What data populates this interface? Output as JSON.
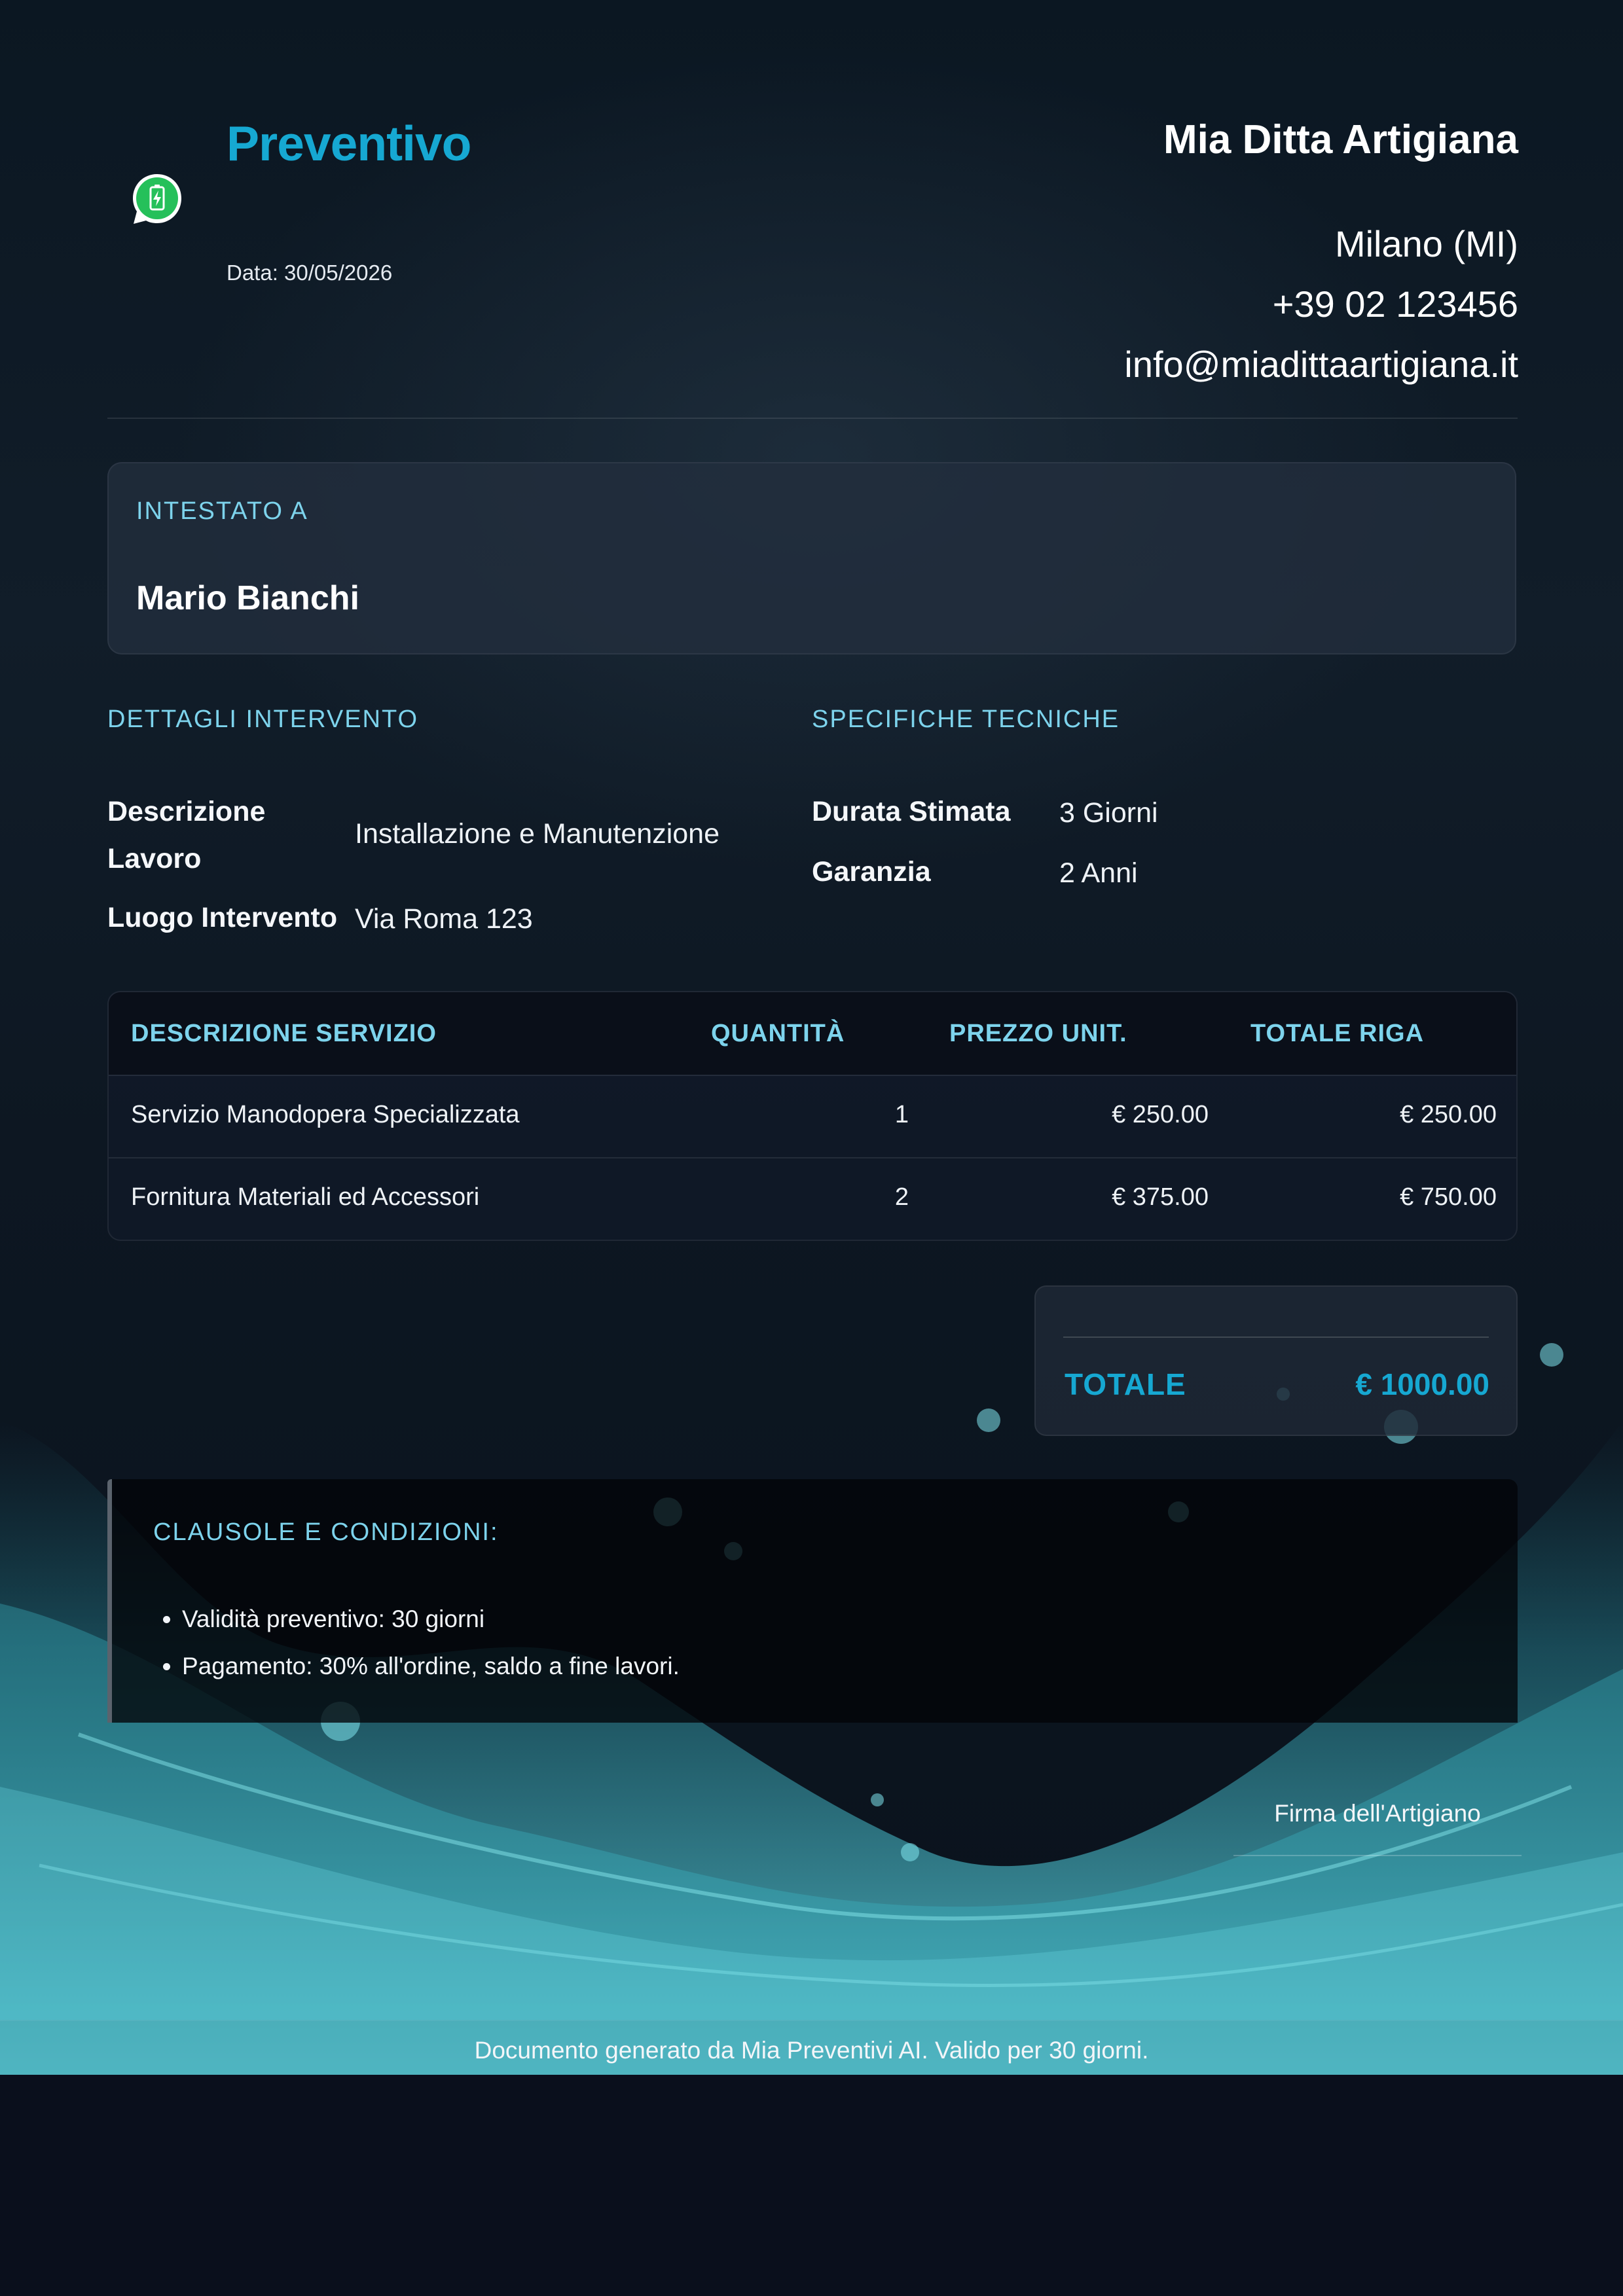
{
  "header": {
    "title": "Preventivo",
    "date": "Data: 30/05/2026",
    "icon": "whatsapp-icon",
    "accent_color": "#16a8d2"
  },
  "company": {
    "name": "Mia Ditta Artigiana",
    "city": "Milano (MI)",
    "phone": "+39 02 123456",
    "email": "info@miadittaartigiana.it"
  },
  "client": {
    "label": "INTESTATO A",
    "name": "Mario Bianchi"
  },
  "details": {
    "title": "DETTAGLI INTERVENTO",
    "description_key_line1": "Descrizione",
    "description_key_line2": "Lavoro",
    "description_value": "Installazione e Manutenzione",
    "location_key": "Luogo Intervento",
    "location_value": "Via Roma 123"
  },
  "specs": {
    "title": "SPECIFICHE TECNICHE",
    "duration_key": "Durata Stimata",
    "duration_value": "3 Giorni",
    "warranty_key": "Garanzia",
    "warranty_value": "2 Anni"
  },
  "table": {
    "headers": [
      "DESCRIZIONE SERVIZIO",
      "QUANTITÀ",
      "PREZZO UNIT.",
      "TOTALE RIGA"
    ],
    "rows": [
      {
        "description": "Servizio Manodopera Specializzata",
        "qty": "1",
        "unit": "€ 250.00",
        "total": "€ 250.00"
      },
      {
        "description": "Fornitura Materiali ed Accessori",
        "qty": "2",
        "unit": "€ 375.00",
        "total": "€ 750.00"
      }
    ]
  },
  "summary": {
    "total_label": "TOTALE",
    "total_value": "€ 1000.00"
  },
  "clauses": {
    "title": "CLAUSOLE E CONDIZIONI:",
    "items": [
      "Validità preventivo: 30 giorni",
      "Pagamento: 30% all'ordine, saldo a fine lavori."
    ]
  },
  "signature": {
    "label": "Firma dell'Artigiano"
  },
  "footer": {
    "text": "Documento generato da Mia Preventivi AI. Valido per 30 giorni."
  }
}
